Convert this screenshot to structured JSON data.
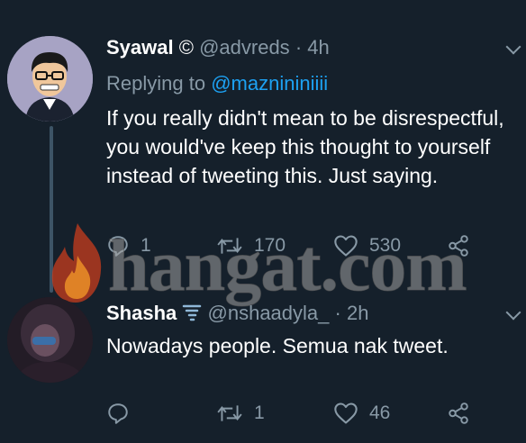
{
  "tweet1": {
    "name": "Syawal",
    "verified_glyph": "©",
    "handle": "@advreds",
    "separator": "·",
    "time": "4h",
    "replying_prefix": "Replying to",
    "replying_to": "@maznininiiii",
    "text": "If you really didn't mean to be disrespectful, you would've keep this thought to yourself instead of tweeting this. Just saying.",
    "reply_count": "1",
    "retweet_count": "170",
    "like_count": "530"
  },
  "tweet2": {
    "name": "Shasha",
    "emoji_icon": "tornado-icon",
    "handle": "@nshaadyla_",
    "separator": "·",
    "time": "2h",
    "text": "Nowadays people. Semua nak tweet.",
    "reply_count": "",
    "retweet_count": "1",
    "like_count": "46"
  },
  "watermark": {
    "text": "hangat.com",
    "icon": "flame-icon"
  },
  "colors": {
    "background": "#15202b",
    "primary_text": "#ffffff",
    "secondary_text": "#8899a6",
    "link": "#1da1f2",
    "divider": "#38444d"
  }
}
